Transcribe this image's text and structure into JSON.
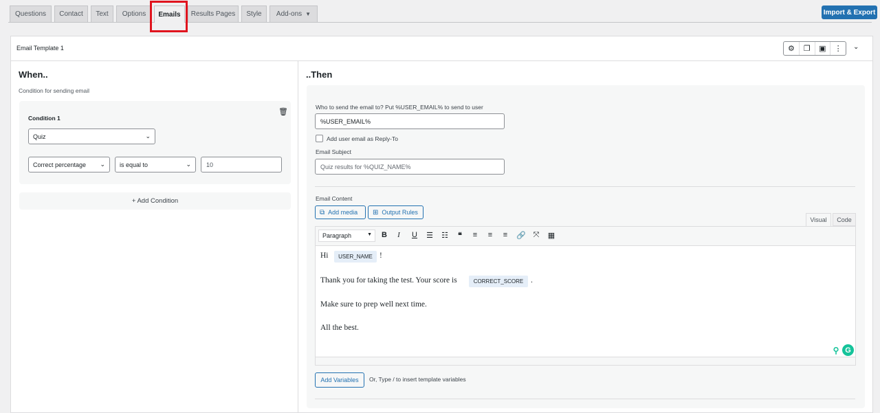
{
  "tabs": [
    {
      "label": "Questions"
    },
    {
      "label": "Contact"
    },
    {
      "label": "Text"
    },
    {
      "label": "Options"
    },
    {
      "label": "Emails",
      "active": true
    },
    {
      "label": "Results Pages"
    },
    {
      "label": "Style"
    },
    {
      "label": "Add-ons"
    }
  ],
  "header": {
    "import_export_label": "Import & Export"
  },
  "template": {
    "title": "Email Template 1"
  },
  "when": {
    "heading": "When..",
    "subheading": "Condition for sending email",
    "condition": {
      "title": "Condition 1",
      "category": "Quiz",
      "field": "Correct percentage",
      "operator": "is equal to",
      "value": "10"
    },
    "add_condition_label": "+ Add Condition"
  },
  "then": {
    "heading": "..Then",
    "to_label": "Who to send the email to? Put %USER_EMAIL% to send to user",
    "to_value": "%USER_EMAIL%",
    "reply_to_label": "Add user email as Reply-To",
    "subject_label": "Email Subject",
    "subject_placeholder": "Quiz results for %QUIZ_NAME%",
    "content_label": "Email Content",
    "add_media_label": "Add media",
    "output_rules_label": "Output Rules",
    "visual_tab": "Visual",
    "code_tab": "Code",
    "format_select": "Paragraph",
    "body": {
      "line1_pre": "Hi",
      "line1_var": "USER_NAME",
      "line1_post": "!",
      "line2_pre": "Thank you for taking the test. Your score is",
      "line2_var": "CORRECT_SCORE",
      "line2_post": ".",
      "line3": "Make sure to prep well next time.",
      "line4": "All the best."
    },
    "add_variables_label": "Add Variables",
    "hint": "Or, Type / to insert template variables"
  },
  "colors": {
    "primary": "#2271b1",
    "highlight": "#e0141e",
    "grammarly": "#15c39a"
  }
}
